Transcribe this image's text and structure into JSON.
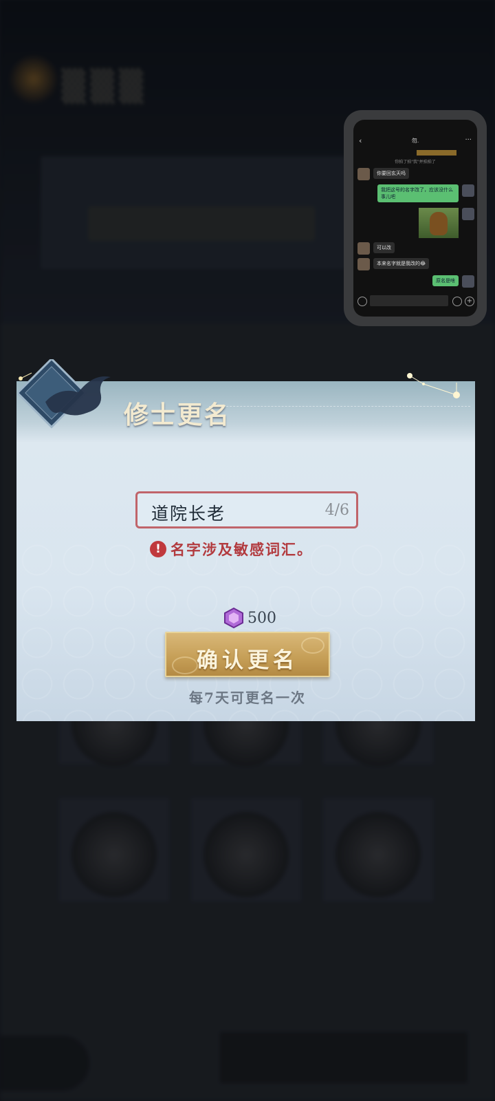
{
  "dialog": {
    "title": "修士更名",
    "name_value": "道院长老",
    "name_counter": "4/6",
    "error_message": "名字涉及敏感词汇。",
    "error_icon_glyph": "!",
    "cost_value": "500",
    "confirm_label": "确认更名",
    "limit_note": "每7天可更名一次",
    "icons": {
      "error": "exclamation-circle-icon",
      "currency": "purple-gem-icon"
    },
    "colors": {
      "error": "#c0393d",
      "button": "#c9a25c",
      "input_border": "#c0646a"
    }
  },
  "phone_overlay": {
    "chat_title": "勿.",
    "system_note": "你拍了拍\"我\"并拍拍了",
    "messages": [
      {
        "from": "other",
        "text": "你要回玄天吗"
      },
      {
        "from": "me",
        "text": "我把这号的名字改了，应该没什么事儿吧"
      },
      {
        "from": "me",
        "text": ""
      },
      {
        "from": "other",
        "text": "可以改"
      },
      {
        "from": "other",
        "text": "本来名字就是我改的😂"
      },
      {
        "from": "me",
        "text": "原名是啥"
      }
    ]
  }
}
